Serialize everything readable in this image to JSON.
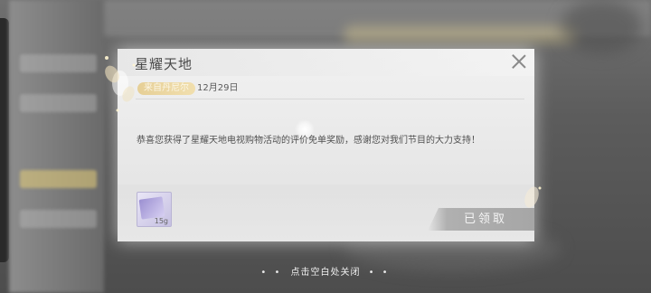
{
  "dialog": {
    "title": "星耀天地",
    "sender": "来自丹尼尔",
    "date": "12月29日",
    "message": "恭喜您获得了星耀天地电视购物活动的评价免单奖励，感谢您对我们节目的大力支持！",
    "close_icon": "close-icon",
    "reward": {
      "icon": "gift-card-icon",
      "count": "15g",
      "status_label": "已领取"
    }
  },
  "footer": {
    "close_hint": "点击空白处关闭",
    "hint_dots_left": "• •",
    "hint_dots_right": "• •"
  },
  "colors": {
    "accent_badge": "#e6cf96",
    "claimed_button": "#a9a9a9",
    "dialog_bg": "#f2f2f2"
  }
}
